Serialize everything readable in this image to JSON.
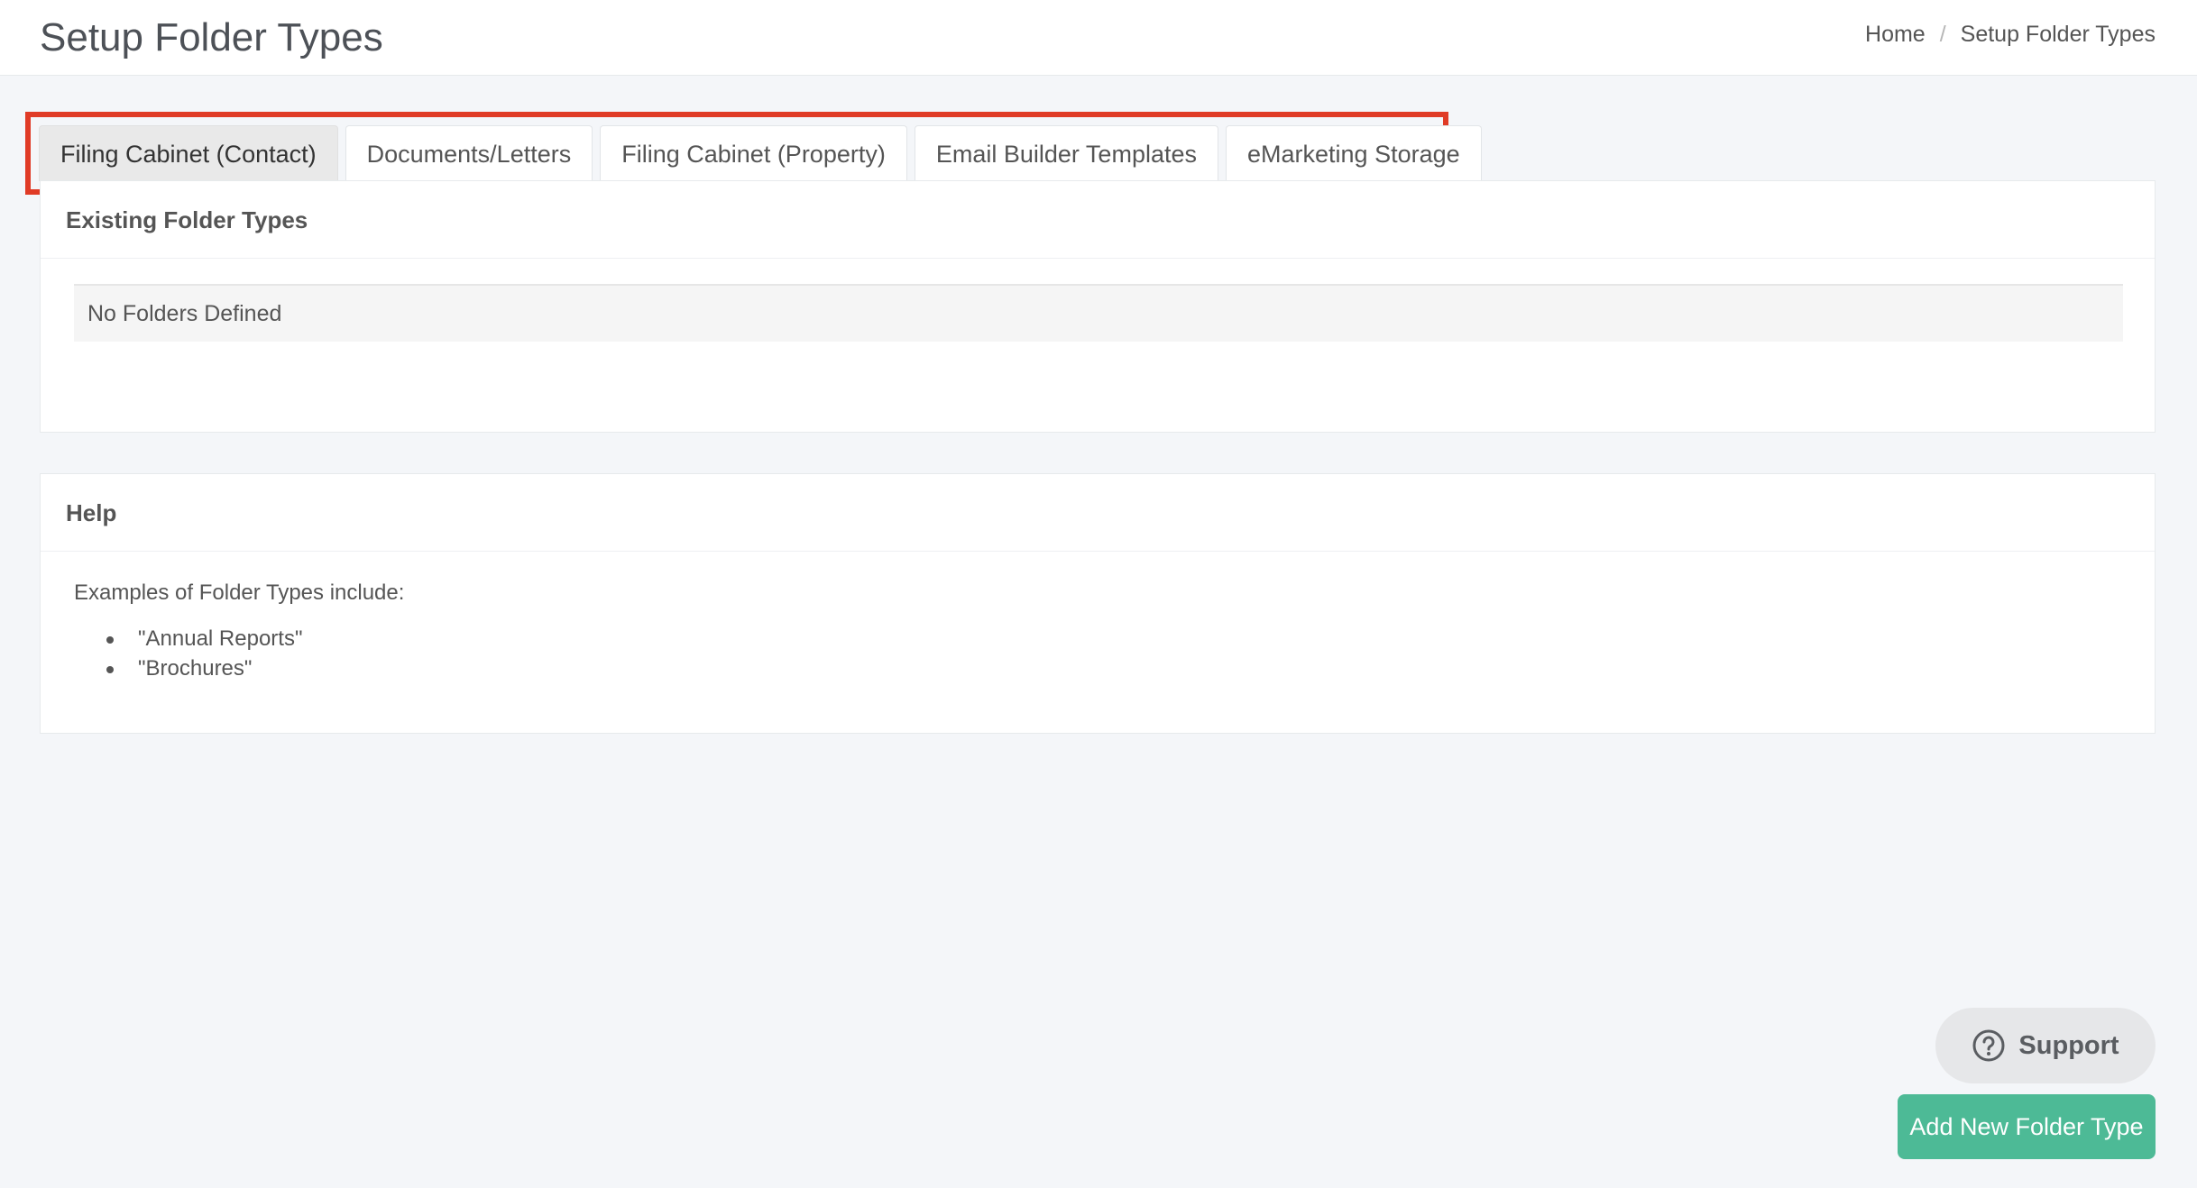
{
  "header": {
    "title": "Setup Folder Types",
    "breadcrumb": {
      "home": "Home",
      "separator": "/",
      "current": "Setup Folder Types"
    }
  },
  "tabs": [
    {
      "label": "Filing Cabinet (Contact)",
      "active": true
    },
    {
      "label": "Documents/Letters",
      "active": false
    },
    {
      "label": "Filing Cabinet (Property)",
      "active": false
    },
    {
      "label": "Email Builder Templates",
      "active": false
    },
    {
      "label": "eMarketing Storage",
      "active": false
    }
  ],
  "existing_panel": {
    "heading": "Existing Folder Types",
    "empty_message": "No Folders Defined"
  },
  "help_panel": {
    "heading": "Help",
    "intro": "Examples of Folder Types include:",
    "examples": [
      "\"Annual Reports\"",
      "\"Brochures\""
    ]
  },
  "support_button": {
    "label": "Support",
    "icon": "question-circle-icon"
  },
  "add_button": {
    "label": "Add New Folder Type"
  },
  "colors": {
    "accent": "#4dba96",
    "highlight_border": "#e03b26",
    "active_tab": "#e9e9e9",
    "background": "#f4f6f9"
  }
}
